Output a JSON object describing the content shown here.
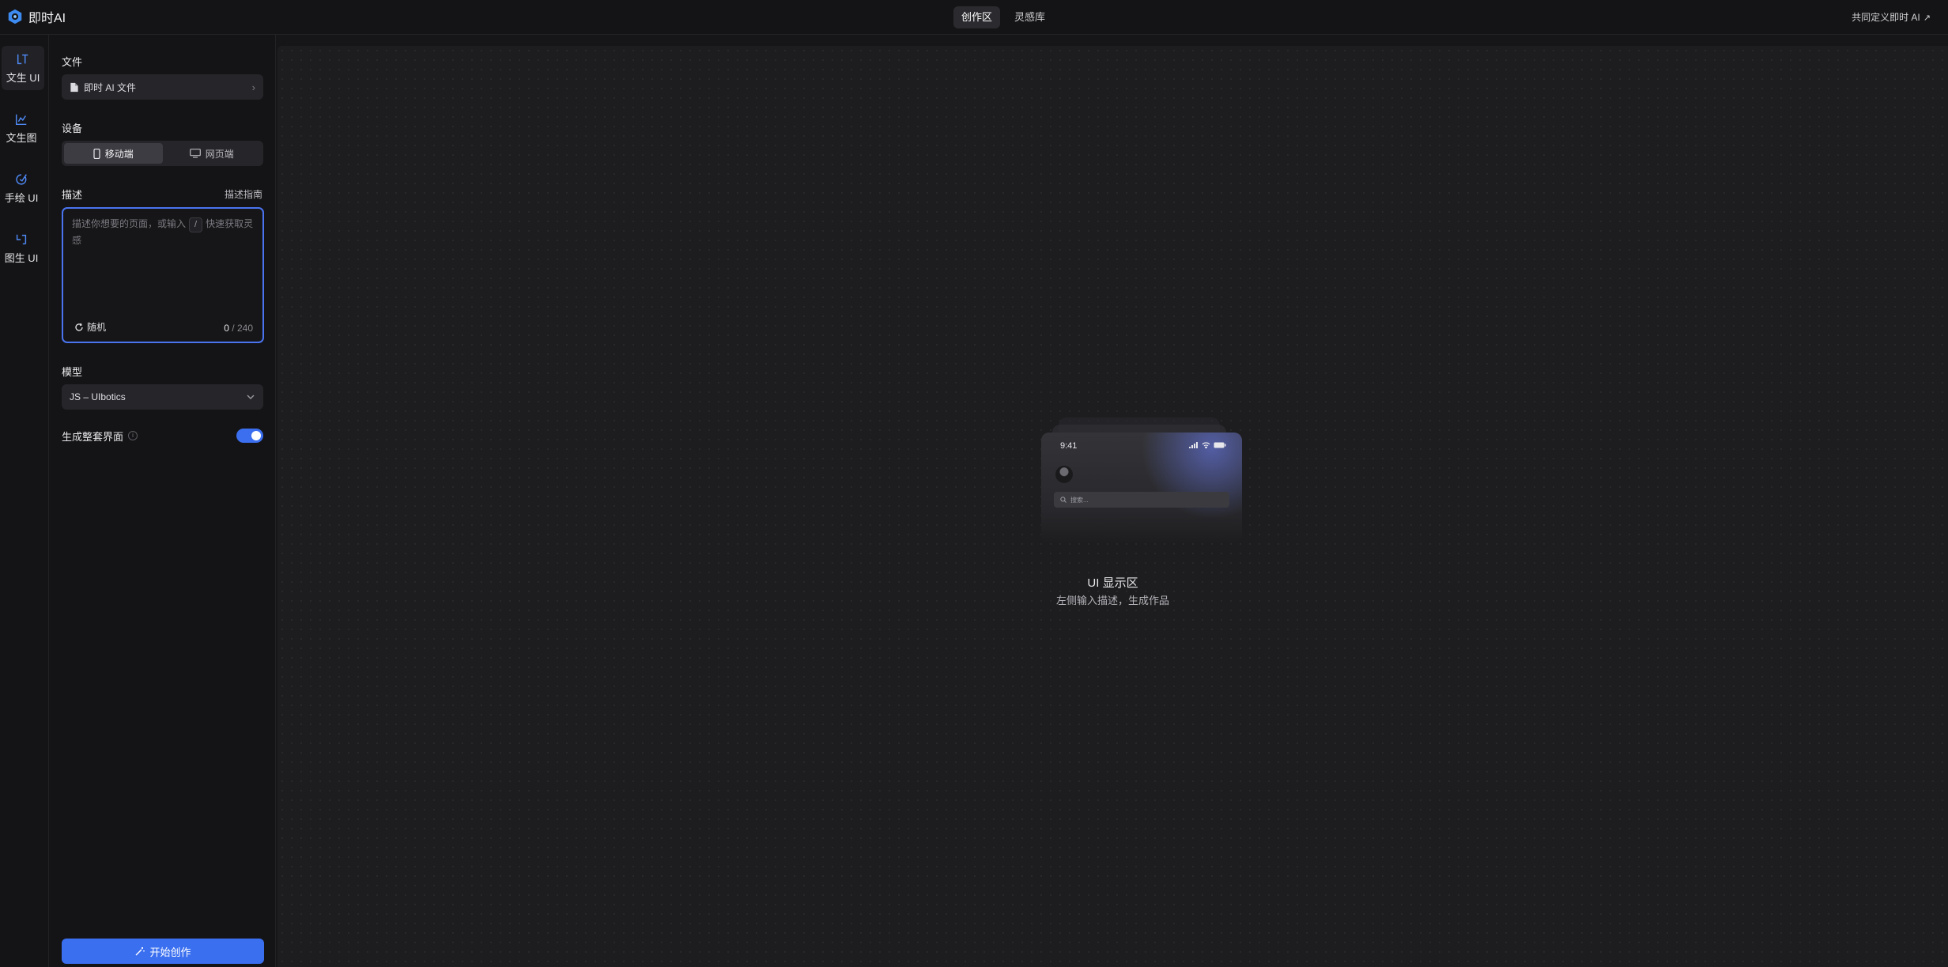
{
  "app": {
    "name": "即时AI"
  },
  "header": {
    "tabs": [
      {
        "label": "创作区",
        "active": true
      },
      {
        "label": "灵感库",
        "active": false
      }
    ],
    "right_link": "共同定义即时 AI"
  },
  "rail": {
    "items": [
      {
        "label": "文生 UI",
        "icon": "text-ui-icon",
        "active": true
      },
      {
        "label": "文生图",
        "icon": "chart-icon",
        "active": false
      },
      {
        "label": "手绘 UI",
        "icon": "sketch-icon",
        "active": false
      },
      {
        "label": "图生 UI",
        "icon": "image-ui-icon",
        "active": false
      }
    ]
  },
  "panel": {
    "file": {
      "title": "文件",
      "value": "即时 AI 文件"
    },
    "device": {
      "title": "设备",
      "options": [
        "移动端",
        "网页端"
      ],
      "selected": "移动端"
    },
    "description": {
      "title": "描述",
      "guide": "描述指南",
      "placeholder_before": "描述你想要的页面，或输入",
      "placeholder_key": "/",
      "placeholder_after": "快速获取灵感",
      "value": "",
      "random_label": "随机",
      "count_current": "0",
      "count_max": "/ 240"
    },
    "model": {
      "title": "模型",
      "selected": "JS – UIbotics"
    },
    "generate_full": {
      "label": "生成整套界面",
      "enabled": true
    },
    "start_button": "开始创作"
  },
  "canvas": {
    "phone": {
      "time": "9:41",
      "search_placeholder": "搜索..."
    },
    "empty_title": "UI 显示区",
    "empty_subtitle": "左侧输入描述，生成作品"
  },
  "colors": {
    "accent": "#3a6ff0",
    "background": "#161618",
    "canvas": "#1d1d1f"
  }
}
